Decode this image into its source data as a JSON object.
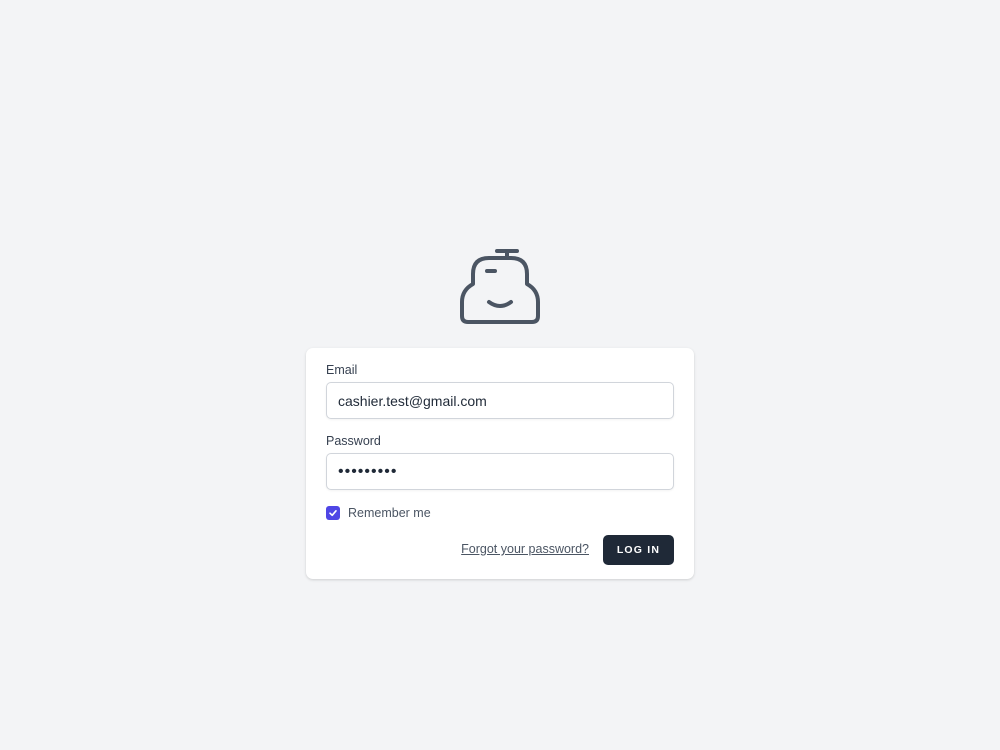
{
  "app": {
    "logo_icon": "cash-register-icon",
    "background_color": "#f3f4f6"
  },
  "form": {
    "email_label": "Email",
    "email_value": "cashier.test@gmail.com",
    "password_label": "Password",
    "password_value": "•••••••••",
    "remember_label": "Remember me",
    "remember_checked": true,
    "forgot_link": "Forgot your password?",
    "login_button": "LOG IN"
  },
  "colors": {
    "accent": "#4f46e5",
    "button_bg": "#1f2937",
    "card_bg": "#ffffff"
  }
}
